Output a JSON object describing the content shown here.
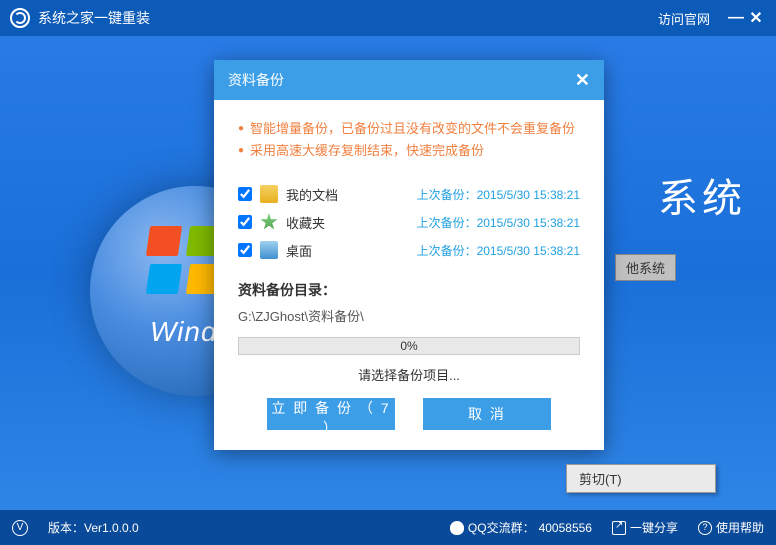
{
  "titlebar": {
    "app_name": "系统之家一键重装",
    "visit_link": "访问官网"
  },
  "background": {
    "os_text": "Windo",
    "headline_suffix": "系统",
    "other_sys_btn": "他系统"
  },
  "modal": {
    "title": "资料备份",
    "bullets": [
      "智能增量备份，已备份过且没有改变的文件不会重复备份",
      "采用高速大缓存复制结束，快速完成备份"
    ],
    "items": [
      {
        "name": "我的文档",
        "time_label": "上次备份：2015/5/30 15:38:21",
        "checked": true,
        "icon": "docs"
      },
      {
        "name": "收藏夹",
        "time_label": "上次备份：2015/5/30 15:38:21",
        "checked": true,
        "icon": "fav"
      },
      {
        "name": "桌面",
        "time_label": "上次备份：2015/5/30 15:38:21",
        "checked": true,
        "icon": "desk"
      }
    ],
    "dir_label": "资料备份目录：",
    "dir_path": "G:\\ZJGhost\\资料备份\\",
    "progress_pct": "0%",
    "status_msg": "请选择备份项目...",
    "backup_btn": "立 即 备 份 （ 7 ）",
    "cancel_btn": "取    消"
  },
  "context_menu": {
    "cut": "剪切(T)"
  },
  "statusbar": {
    "version_label": "版本：",
    "version": "Ver1.0.0.0",
    "qq_label": "QQ交流群：",
    "qq_group": "40058556",
    "share": "一键分享",
    "help": "使用帮助"
  }
}
